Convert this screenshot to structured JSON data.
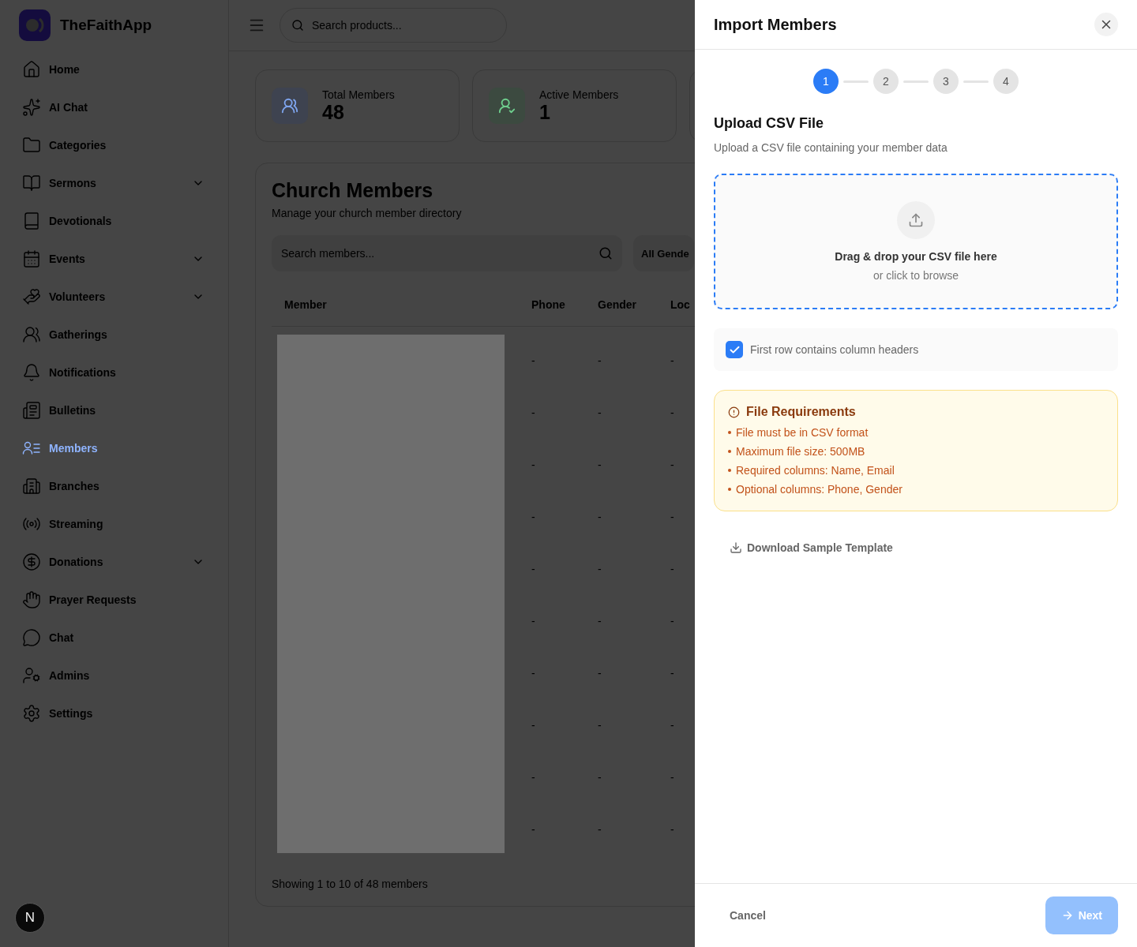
{
  "brand": {
    "name": "TheFaithApp"
  },
  "sidebar": {
    "items": [
      {
        "label": "Home",
        "expandable": false,
        "selected": false
      },
      {
        "label": "AI Chat",
        "expandable": false,
        "selected": false
      },
      {
        "label": "Categories",
        "expandable": false,
        "selected": false
      },
      {
        "label": "Sermons",
        "expandable": true,
        "selected": false
      },
      {
        "label": "Devotionals",
        "expandable": false,
        "selected": false
      },
      {
        "label": "Events",
        "expandable": true,
        "selected": false
      },
      {
        "label": "Volunteers",
        "expandable": true,
        "selected": false
      },
      {
        "label": "Gatherings",
        "expandable": false,
        "selected": false
      },
      {
        "label": "Notifications",
        "expandable": false,
        "selected": false
      },
      {
        "label": "Bulletins",
        "expandable": false,
        "selected": false
      },
      {
        "label": "Members",
        "expandable": false,
        "selected": true
      },
      {
        "label": "Branches",
        "expandable": false,
        "selected": false
      },
      {
        "label": "Streaming",
        "expandable": false,
        "selected": false
      },
      {
        "label": "Donations",
        "expandable": true,
        "selected": false
      },
      {
        "label": "Prayer Requests",
        "expandable": false,
        "selected": false
      },
      {
        "label": "Chat",
        "expandable": false,
        "selected": false
      },
      {
        "label": "Admins",
        "expandable": false,
        "selected": false
      },
      {
        "label": "Settings",
        "expandable": false,
        "selected": false
      }
    ]
  },
  "avatar": {
    "letter": "N"
  },
  "topbar": {
    "search_placeholder": "Search products..."
  },
  "stats": [
    {
      "label": "Total Members",
      "value": "48",
      "kind": "total"
    },
    {
      "label": "Active Members",
      "value": "1",
      "kind": "active"
    }
  ],
  "members_card": {
    "title": "Church Members",
    "subtitle": "Manage your church member directory",
    "search_placeholder": "Search members...",
    "filter": "All Gende",
    "columns": [
      "Member",
      "Phone",
      "Gender",
      "Loc"
    ],
    "rows": [
      [
        "",
        "-",
        "-",
        "-"
      ],
      [
        "",
        "-",
        "-",
        "-"
      ],
      [
        "",
        "-",
        "-",
        "-"
      ],
      [
        "",
        "-",
        "-",
        "-"
      ],
      [
        "",
        "-",
        "-",
        "-"
      ],
      [
        "",
        "-",
        "-",
        "-"
      ],
      [
        "",
        "-",
        "-",
        "-"
      ],
      [
        "",
        "-",
        "-",
        "-"
      ],
      [
        "",
        "-",
        "-",
        "-"
      ],
      [
        "",
        "-",
        "-",
        "-"
      ]
    ],
    "footer": "Showing 1 to 10 of 48 members"
  },
  "drawer": {
    "title": "Import Members",
    "steps": [
      {
        "label": "1",
        "selected": true
      },
      {
        "label": "2",
        "selected": false
      },
      {
        "label": "3",
        "selected": false
      },
      {
        "label": "4",
        "selected": false
      }
    ],
    "section_title": "Upload CSV File",
    "section_subtitle": "Upload a CSV file containing your member data",
    "dropzone": {
      "title": "Drag & drop your CSV file here",
      "hint": "or click to browse"
    },
    "checkbox": {
      "label": "First row contains column headers",
      "checked": true
    },
    "requirements": {
      "title": "File Requirements",
      "items": [
        "File must be in CSV format",
        "Maximum file size: 500MB",
        "Required columns: Name, Email",
        "Optional columns: Phone, Gender"
      ]
    },
    "download": "Download Sample Template",
    "cancel": "Cancel",
    "next": {
      "label": "Next",
      "disabled": true
    }
  }
}
